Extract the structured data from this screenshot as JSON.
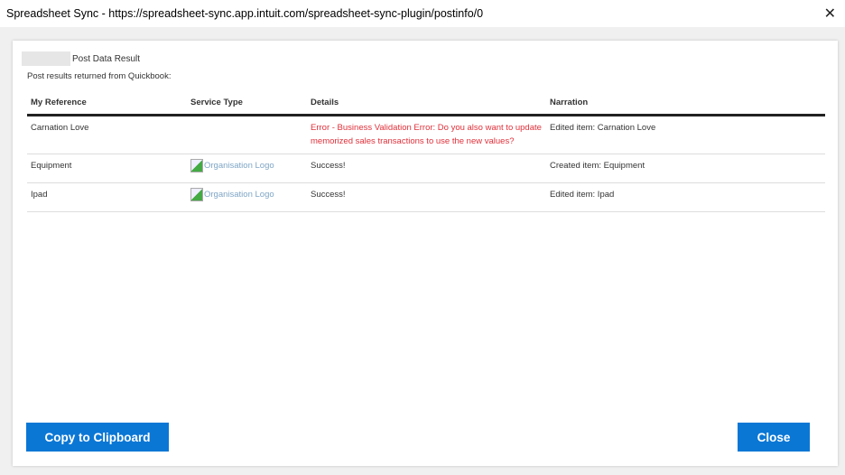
{
  "window": {
    "title": "Spreadsheet Sync - https://spreadsheet-sync.app.intuit.com/spreadsheet-sync-plugin/postinfo/0",
    "close": "✕"
  },
  "dialog": {
    "heading": "Post Data Result",
    "subtitle": "Post results returned from Quickbook:"
  },
  "table": {
    "headers": [
      "My Reference",
      "Service Type",
      "Details",
      "Narration"
    ],
    "rows": [
      {
        "ref": "Carnation Love",
        "service": "",
        "details": "Error - Business Validation Error: Do you also want to update memorized sales transactions to use the new values?",
        "narration": "Edited item: Carnation Love"
      },
      {
        "ref": "Equipment",
        "service": "Organisation Logo",
        "details": "Success!",
        "narration": "Created item: Equipment"
      },
      {
        "ref": "Ipad",
        "service": "Organisation Logo",
        "details": "Success!",
        "narration": "Edited item: Ipad"
      }
    ]
  },
  "buttons": {
    "copy": "Copy to Clipboard",
    "close": "Close"
  }
}
